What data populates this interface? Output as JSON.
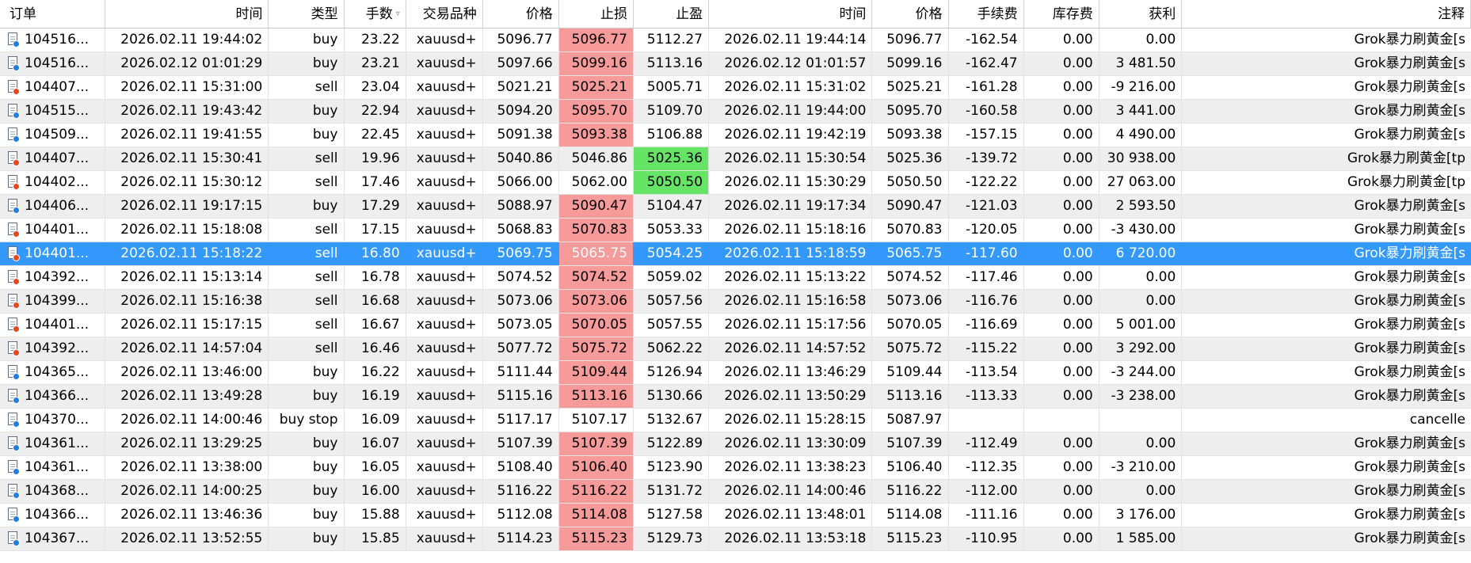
{
  "headers": {
    "order": "订单",
    "time": "时间",
    "type": "类型",
    "lots": "手数",
    "symbol": "交易品种",
    "price": "价格",
    "sl": "止损",
    "tp": "止盈",
    "close_time": "时间",
    "close_price": "价格",
    "fee": "手续费",
    "swap": "库存费",
    "profit": "获利",
    "comment": "注释"
  },
  "sort_icon": "sort-down-icon",
  "colors": {
    "sl_highlight": "#f79a9a",
    "tp_highlight": "#66e466",
    "selection": "#3399ff",
    "buy_dot": "#1f7ee0",
    "sell_dot": "#e8461e"
  },
  "rows": [
    {
      "order": "104516...",
      "time": "2026.02.11 19:44:02",
      "type": "buy",
      "lots": "23.22",
      "symbol": "xauusd+",
      "price": "5096.77",
      "sl": "5096.77",
      "tp": "5112.27",
      "close_time": "2026.02.11 19:44:14",
      "close_price": "5096.77",
      "fee": "-162.54",
      "swap": "0.00",
      "profit": "0.00",
      "comment": "Grok暴力刷黄金[s",
      "sl_hl": true,
      "tp_hl": false,
      "dir": "buy"
    },
    {
      "order": "104516...",
      "time": "2026.02.12 01:01:29",
      "type": "buy",
      "lots": "23.21",
      "symbol": "xauusd+",
      "price": "5097.66",
      "sl": "5099.16",
      "tp": "5113.16",
      "close_time": "2026.02.12 01:01:57",
      "close_price": "5099.16",
      "fee": "-162.47",
      "swap": "0.00",
      "profit": "3 481.50",
      "comment": "Grok暴力刷黄金[s",
      "sl_hl": true,
      "tp_hl": false,
      "dir": "buy"
    },
    {
      "order": "104407...",
      "time": "2026.02.11 15:31:00",
      "type": "sell",
      "lots": "23.04",
      "symbol": "xauusd+",
      "price": "5021.21",
      "sl": "5025.21",
      "tp": "5005.71",
      "close_time": "2026.02.11 15:31:02",
      "close_price": "5025.21",
      "fee": "-161.28",
      "swap": "0.00",
      "profit": "-9 216.00",
      "comment": "Grok暴力刷黄金[s",
      "sl_hl": true,
      "tp_hl": false,
      "dir": "sell"
    },
    {
      "order": "104515...",
      "time": "2026.02.11 19:43:42",
      "type": "buy",
      "lots": "22.94",
      "symbol": "xauusd+",
      "price": "5094.20",
      "sl": "5095.70",
      "tp": "5109.70",
      "close_time": "2026.02.11 19:44:00",
      "close_price": "5095.70",
      "fee": "-160.58",
      "swap": "0.00",
      "profit": "3 441.00",
      "comment": "Grok暴力刷黄金[s",
      "sl_hl": true,
      "tp_hl": false,
      "dir": "buy"
    },
    {
      "order": "104509...",
      "time": "2026.02.11 19:41:55",
      "type": "buy",
      "lots": "22.45",
      "symbol": "xauusd+",
      "price": "5091.38",
      "sl": "5093.38",
      "tp": "5106.88",
      "close_time": "2026.02.11 19:42:19",
      "close_price": "5093.38",
      "fee": "-157.15",
      "swap": "0.00",
      "profit": "4 490.00",
      "comment": "Grok暴力刷黄金[s",
      "sl_hl": true,
      "tp_hl": false,
      "dir": "buy"
    },
    {
      "order": "104407...",
      "time": "2026.02.11 15:30:41",
      "type": "sell",
      "lots": "19.96",
      "symbol": "xauusd+",
      "price": "5040.86",
      "sl": "5046.86",
      "tp": "5025.36",
      "close_time": "2026.02.11 15:30:54",
      "close_price": "5025.36",
      "fee": "-139.72",
      "swap": "0.00",
      "profit": "30 938.00",
      "comment": "Grok暴力刷黄金[tp",
      "sl_hl": false,
      "tp_hl": true,
      "dir": "sell"
    },
    {
      "order": "104402...",
      "time": "2026.02.11 15:30:12",
      "type": "sell",
      "lots": "17.46",
      "symbol": "xauusd+",
      "price": "5066.00",
      "sl": "5062.00",
      "tp": "5050.50",
      "close_time": "2026.02.11 15:30:29",
      "close_price": "5050.50",
      "fee": "-122.22",
      "swap": "0.00",
      "profit": "27 063.00",
      "comment": "Grok暴力刷黄金[tp",
      "sl_hl": false,
      "tp_hl": true,
      "dir": "sell"
    },
    {
      "order": "104406...",
      "time": "2026.02.11 19:17:15",
      "type": "buy",
      "lots": "17.29",
      "symbol": "xauusd+",
      "price": "5088.97",
      "sl": "5090.47",
      "tp": "5104.47",
      "close_time": "2026.02.11 19:17:34",
      "close_price": "5090.47",
      "fee": "-121.03",
      "swap": "0.00",
      "profit": "2 593.50",
      "comment": "Grok暴力刷黄金[s",
      "sl_hl": true,
      "tp_hl": false,
      "dir": "buy"
    },
    {
      "order": "104401...",
      "time": "2026.02.11 15:18:08",
      "type": "sell",
      "lots": "17.15",
      "symbol": "xauusd+",
      "price": "5068.83",
      "sl": "5070.83",
      "tp": "5053.33",
      "close_time": "2026.02.11 15:18:16",
      "close_price": "5070.83",
      "fee": "-120.05",
      "swap": "0.00",
      "profit": "-3 430.00",
      "comment": "Grok暴力刷黄金[s",
      "sl_hl": true,
      "tp_hl": false,
      "dir": "sell"
    },
    {
      "order": "104401...",
      "time": "2026.02.11 15:18:22",
      "type": "sell",
      "lots": "16.80",
      "symbol": "xauusd+",
      "price": "5069.75",
      "sl": "5065.75",
      "tp": "5054.25",
      "close_time": "2026.02.11 15:18:59",
      "close_price": "5065.75",
      "fee": "-117.60",
      "swap": "0.00",
      "profit": "6 720.00",
      "comment": "Grok暴力刷黄金[s",
      "sl_hl": true,
      "tp_hl": false,
      "dir": "sell",
      "selected": true
    },
    {
      "order": "104392...",
      "time": "2026.02.11 15:13:14",
      "type": "sell",
      "lots": "16.78",
      "symbol": "xauusd+",
      "price": "5074.52",
      "sl": "5074.52",
      "tp": "5059.02",
      "close_time": "2026.02.11 15:13:22",
      "close_price": "5074.52",
      "fee": "-117.46",
      "swap": "0.00",
      "profit": "0.00",
      "comment": "Grok暴力刷黄金[s",
      "sl_hl": true,
      "tp_hl": false,
      "dir": "sell"
    },
    {
      "order": "104399...",
      "time": "2026.02.11 15:16:38",
      "type": "sell",
      "lots": "16.68",
      "symbol": "xauusd+",
      "price": "5073.06",
      "sl": "5073.06",
      "tp": "5057.56",
      "close_time": "2026.02.11 15:16:58",
      "close_price": "5073.06",
      "fee": "-116.76",
      "swap": "0.00",
      "profit": "0.00",
      "comment": "Grok暴力刷黄金[s",
      "sl_hl": true,
      "tp_hl": false,
      "dir": "sell"
    },
    {
      "order": "104401...",
      "time": "2026.02.11 15:17:15",
      "type": "sell",
      "lots": "16.67",
      "symbol": "xauusd+",
      "price": "5073.05",
      "sl": "5070.05",
      "tp": "5057.55",
      "close_time": "2026.02.11 15:17:56",
      "close_price": "5070.05",
      "fee": "-116.69",
      "swap": "0.00",
      "profit": "5 001.00",
      "comment": "Grok暴力刷黄金[s",
      "sl_hl": true,
      "tp_hl": false,
      "dir": "sell"
    },
    {
      "order": "104392...",
      "time": "2026.02.11 14:57:04",
      "type": "sell",
      "lots": "16.46",
      "symbol": "xauusd+",
      "price": "5077.72",
      "sl": "5075.72",
      "tp": "5062.22",
      "close_time": "2026.02.11 14:57:52",
      "close_price": "5075.72",
      "fee": "-115.22",
      "swap": "0.00",
      "profit": "3 292.00",
      "comment": "Grok暴力刷黄金[s",
      "sl_hl": true,
      "tp_hl": false,
      "dir": "sell"
    },
    {
      "order": "104365...",
      "time": "2026.02.11 13:46:00",
      "type": "buy",
      "lots": "16.22",
      "symbol": "xauusd+",
      "price": "5111.44",
      "sl": "5109.44",
      "tp": "5126.94",
      "close_time": "2026.02.11 13:46:29",
      "close_price": "5109.44",
      "fee": "-113.54",
      "swap": "0.00",
      "profit": "-3 244.00",
      "comment": "Grok暴力刷黄金[s",
      "sl_hl": true,
      "tp_hl": false,
      "dir": "buy"
    },
    {
      "order": "104366...",
      "time": "2026.02.11 13:49:28",
      "type": "buy",
      "lots": "16.19",
      "symbol": "xauusd+",
      "price": "5115.16",
      "sl": "5113.16",
      "tp": "5130.66",
      "close_time": "2026.02.11 13:50:29",
      "close_price": "5113.16",
      "fee": "-113.33",
      "swap": "0.00",
      "profit": "-3 238.00",
      "comment": "Grok暴力刷黄金[s",
      "sl_hl": true,
      "tp_hl": false,
      "dir": "buy"
    },
    {
      "order": "104370...",
      "time": "2026.02.11 14:00:46",
      "type": "buy stop",
      "lots": "16.09",
      "symbol": "xauusd+",
      "price": "5117.17",
      "sl": "5107.17",
      "tp": "5132.67",
      "close_time": "2026.02.11 15:28:15",
      "close_price": "5087.97",
      "fee": "",
      "swap": "",
      "profit": "",
      "comment": "cancelle",
      "sl_hl": false,
      "tp_hl": false,
      "dir": "buy"
    },
    {
      "order": "104361...",
      "time": "2026.02.11 13:29:25",
      "type": "buy",
      "lots": "16.07",
      "symbol": "xauusd+",
      "price": "5107.39",
      "sl": "5107.39",
      "tp": "5122.89",
      "close_time": "2026.02.11 13:30:09",
      "close_price": "5107.39",
      "fee": "-112.49",
      "swap": "0.00",
      "profit": "0.00",
      "comment": "Grok暴力刷黄金[s",
      "sl_hl": true,
      "tp_hl": false,
      "dir": "buy"
    },
    {
      "order": "104361...",
      "time": "2026.02.11 13:38:00",
      "type": "buy",
      "lots": "16.05",
      "symbol": "xauusd+",
      "price": "5108.40",
      "sl": "5106.40",
      "tp": "5123.90",
      "close_time": "2026.02.11 13:38:23",
      "close_price": "5106.40",
      "fee": "-112.35",
      "swap": "0.00",
      "profit": "-3 210.00",
      "comment": "Grok暴力刷黄金[s",
      "sl_hl": true,
      "tp_hl": false,
      "dir": "buy"
    },
    {
      "order": "104368...",
      "time": "2026.02.11 14:00:25",
      "type": "buy",
      "lots": "16.00",
      "symbol": "xauusd+",
      "price": "5116.22",
      "sl": "5116.22",
      "tp": "5131.72",
      "close_time": "2026.02.11 14:00:46",
      "close_price": "5116.22",
      "fee": "-112.00",
      "swap": "0.00",
      "profit": "0.00",
      "comment": "Grok暴力刷黄金[s",
      "sl_hl": true,
      "tp_hl": false,
      "dir": "buy"
    },
    {
      "order": "104366...",
      "time": "2026.02.11 13:46:36",
      "type": "buy",
      "lots": "15.88",
      "symbol": "xauusd+",
      "price": "5112.08",
      "sl": "5114.08",
      "tp": "5127.58",
      "close_time": "2026.02.11 13:48:01",
      "close_price": "5114.08",
      "fee": "-111.16",
      "swap": "0.00",
      "profit": "3 176.00",
      "comment": "Grok暴力刷黄金[s",
      "sl_hl": true,
      "tp_hl": false,
      "dir": "buy"
    },
    {
      "order": "104367...",
      "time": "2026.02.11 13:52:55",
      "type": "buy",
      "lots": "15.85",
      "symbol": "xauusd+",
      "price": "5114.23",
      "sl": "5115.23",
      "tp": "5129.73",
      "close_time": "2026.02.11 13:53:18",
      "close_price": "5115.23",
      "fee": "-110.95",
      "swap": "0.00",
      "profit": "1 585.00",
      "comment": "Grok暴力刷黄金[s",
      "sl_hl": true,
      "tp_hl": false,
      "dir": "buy"
    }
  ]
}
